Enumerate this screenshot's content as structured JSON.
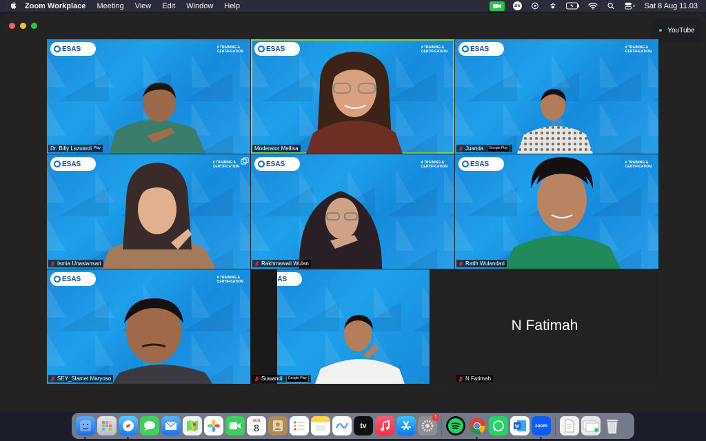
{
  "menubar": {
    "app_name": "Zoom Workplace",
    "menus": [
      "Meeting",
      "View",
      "Edit",
      "Window",
      "Help"
    ],
    "datetime": "Sat 8 Aug  11.03",
    "zoom_status_label": "zm"
  },
  "youtube_pill": {
    "label": "YouTube"
  },
  "tiles": [
    {
      "name": "Dr. Billy Lazuardi",
      "suffix": "Play",
      "muted": false,
      "active": false
    },
    {
      "name": "Moderator Mellisa",
      "muted": false,
      "active": true
    },
    {
      "name": "Juanda",
      "muted": true,
      "active": false,
      "store": "Google Play"
    },
    {
      "name": "Ismia Unasiansari",
      "muted": true,
      "active": false
    },
    {
      "name": "Rakhmawati Wulan",
      "muted": true,
      "active": false
    },
    {
      "name": "Ratih Wulandari",
      "muted": true,
      "active": false
    },
    {
      "name": "SEY_Slamet Maryoso",
      "muted": true,
      "active": false
    },
    {
      "name": "Suwandi",
      "muted": true,
      "active": false,
      "store": "Google Play"
    },
    {
      "name": "N Fatimah",
      "muted": true,
      "active": false,
      "video_off": true,
      "big_label": "N Fatimah"
    }
  ],
  "branding": {
    "logo_text": "ESAS",
    "tag_line1": "# TRAINING &",
    "tag_line2": "CERTIFICATION"
  },
  "dock": {
    "calendar_month": "AUG",
    "calendar_day": "8",
    "appletv_label": "tv",
    "zoom_label": "zoom",
    "settings_badge": "1"
  },
  "colors": {
    "tile_blue": "#1f9ae8",
    "active_border": "#7ad65b",
    "menubar": "#2a2c38",
    "window": "#232323"
  }
}
